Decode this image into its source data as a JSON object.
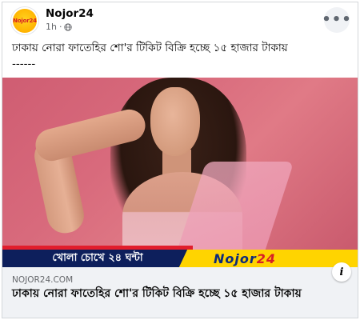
{
  "post": {
    "page_name": "Nojor24",
    "avatar_text": "Nojor24",
    "time": "1h",
    "separator": "·",
    "more_label": "•••",
    "caption_line1": "ঢাকায় নোরা ফাতেহির শো'র টিকিট বিক্রি হচ্ছে ১৫ হাজার টাকায়",
    "caption_line2": "------"
  },
  "image": {
    "banner_left": "খোলা চোখে ২৪ ঘন্টা",
    "banner_right_word": "Nojor",
    "banner_right_num": "24",
    "colors": {
      "background": "#d86a7c",
      "banner_left": "#0d1f5c",
      "banner_right": "#ffd400",
      "banner_red": "#e11d2c"
    }
  },
  "link": {
    "domain": "NOJOR24.COM",
    "title": "ঢাকায় নোরা ফাতেহির শো'র টিকিট বিক্রি হচ্ছে ১৫ হাজার টাকায়",
    "info_label": "i"
  },
  "icons": {
    "globe": "globe-icon",
    "more": "more-options-icon",
    "info": "info-icon"
  }
}
